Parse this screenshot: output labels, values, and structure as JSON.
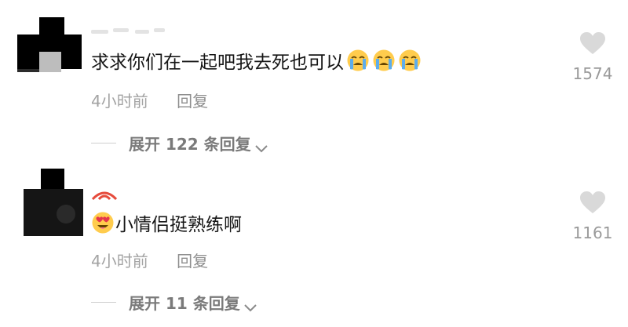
{
  "comments": [
    {
      "text": "求求你们在一起吧我去死也可以",
      "trailing_emoji": [
        "loudly-crying-face",
        "loudly-crying-face",
        "loudly-crying-face"
      ],
      "time": "4小时前",
      "reply_label": "回复",
      "expand_label": "展开 122 条回复",
      "likes": "1574"
    },
    {
      "leading_emoji": "heart-eyes-face",
      "text": "小情侣挺熟练啊",
      "time": "4小时前",
      "reply_label": "回复",
      "expand_label": "展开 11 条回复",
      "likes": "1161"
    }
  ],
  "colors": {
    "text": "#161616",
    "meta": "#a3a3a3",
    "heart": "#d9d9d9",
    "emoji_face": "#ffcc4d",
    "tears": "#5dadec"
  }
}
